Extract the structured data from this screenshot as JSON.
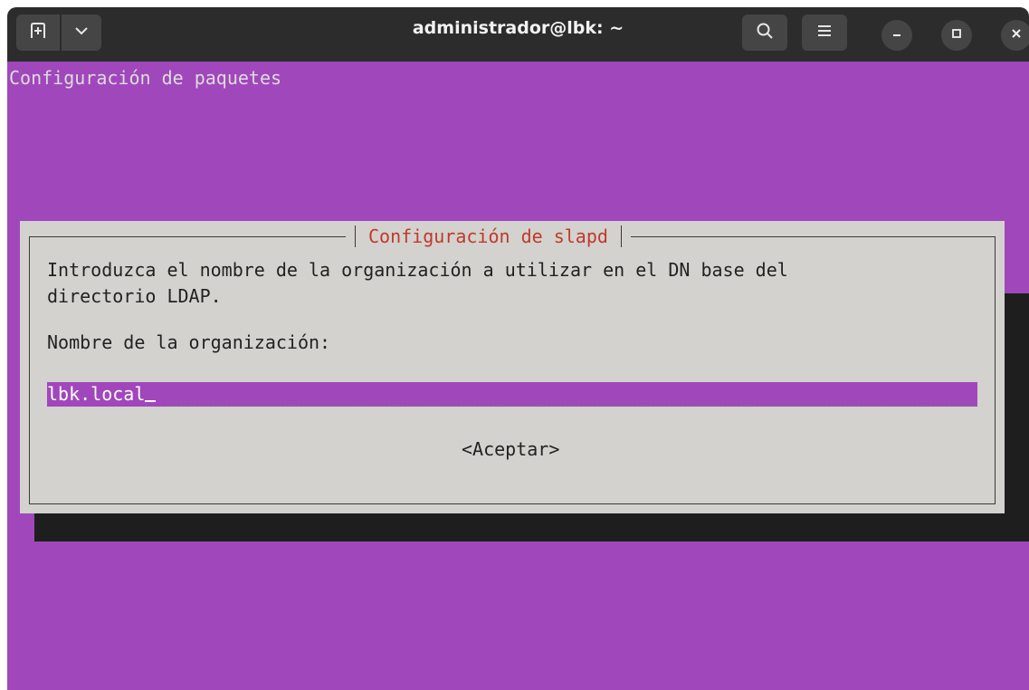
{
  "window": {
    "title": "administrador@lbk: ~"
  },
  "terminal": {
    "backtitle": "Configuración de paquetes",
    "background_color": "#a147bc"
  },
  "dialog": {
    "title": "Configuración de slapd",
    "message": "Introduzca el nombre de la organización a utilizar en el DN base del\ndirectorio LDAP.",
    "field_label": "Nombre de la organización:",
    "input_value": "lbk.local",
    "accept_label": "<Aceptar>",
    "title_color": "#c0392b"
  },
  "icons": {
    "new_tab": "new-tab-icon",
    "tab_menu": "chevron-down-icon",
    "search": "search-icon",
    "menu": "hamburger-menu-icon",
    "minimize": "minimize-icon",
    "maximize": "maximize-icon",
    "close": "close-icon"
  }
}
